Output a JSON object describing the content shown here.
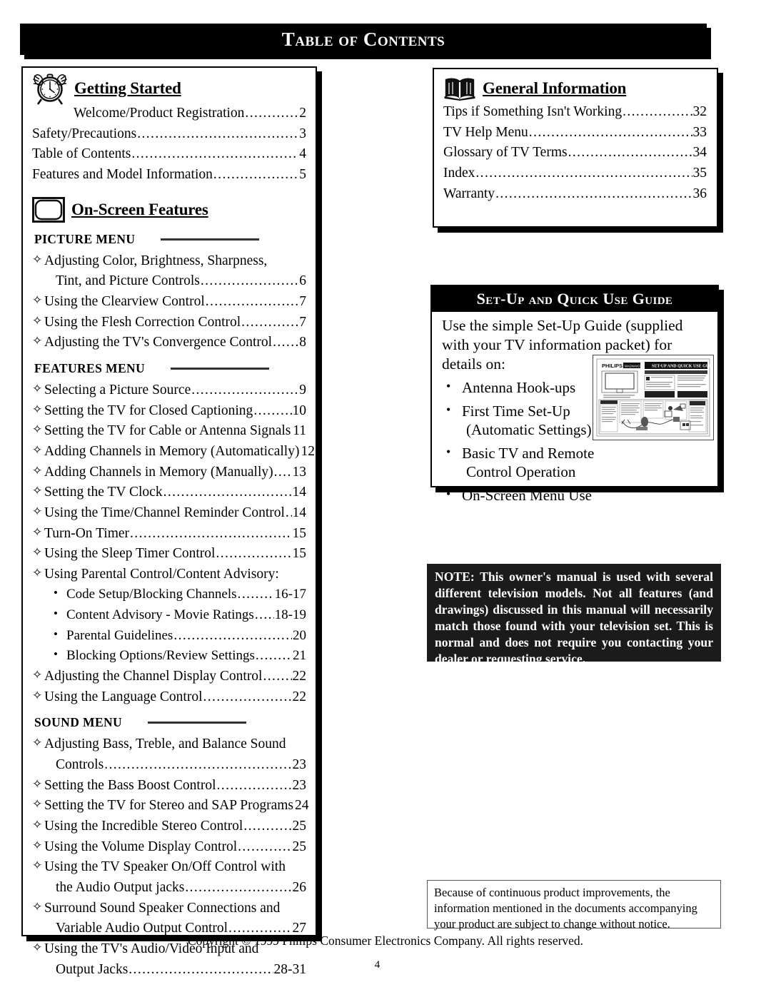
{
  "page": {
    "title": "Table of Contents",
    "page_number": "4",
    "copyright": "Copyright © 1999 Philips Consumer Electronics Company. All rights reserved.",
    "disclaimer": "Because of continuous product improvements, the information mentioned in the documents accompanying your product are subject to change without notice."
  },
  "left_column": {
    "getting_started": {
      "heading": "Getting Started",
      "icon": "alarm-clock-icon",
      "entries": [
        {
          "text": "Welcome/Product Registration",
          "page": "2",
          "indent": true
        },
        {
          "text": "Safety/Precautions",
          "page": "3",
          "indent": false
        },
        {
          "text": "Table of Contents",
          "page": "4",
          "indent": false
        },
        {
          "text": "Features and Model Information",
          "page": "5",
          "indent": false
        }
      ]
    },
    "on_screen_features": {
      "heading": "On-Screen Features",
      "icon": "tv-screen-icon",
      "menus": [
        {
          "label": "PICTURE MENU",
          "entries": [
            {
              "text": "Adjusting Color, Brightness, Sharpness,",
              "page": "",
              "wrap": "Tint, and Picture Controls",
              "wrap_page": "6"
            },
            {
              "text": "Using the Clearview Control",
              "page": "7"
            },
            {
              "text": "Using the Flesh Correction Control",
              "page": "7"
            },
            {
              "text": "Adjusting the TV's Convergence Control",
              "page": "8"
            }
          ]
        },
        {
          "label": "FEATURES MENU",
          "entries": [
            {
              "text": "Selecting a Picture Source",
              "page": "9"
            },
            {
              "text": "Setting the TV for Closed Captioning",
              "page": "10"
            },
            {
              "text": "Setting the TV for Cable or Antenna Signals",
              "page": "11"
            },
            {
              "text": "Adding Channels in Memory (Automatically)",
              "page": "12"
            },
            {
              "text": "Adding Channels in Memory (Manually)",
              "page": "13"
            },
            {
              "text": "Setting the TV Clock",
              "page": "14"
            },
            {
              "text": "Using the Time/Channel Reminder Control",
              "page": "14"
            },
            {
              "text": "Turn-On Timer",
              "page": "15"
            },
            {
              "text": "Using the Sleep Timer Control",
              "page": "15"
            },
            {
              "text": "Using Parental Control/Content Advisory:",
              "page": ""
            }
          ],
          "sub_entries": [
            {
              "text": "Code Setup/Blocking Channels",
              "page": "16-17"
            },
            {
              "text": "Content Advisory - Movie Ratings",
              "page": "18-19"
            },
            {
              "text": "Parental Guidelines",
              "page": "20"
            },
            {
              "text": "Blocking Options/Review Settings",
              "page": "21"
            }
          ],
          "entries_after": [
            {
              "text": "Adjusting the Channel Display Control",
              "page": "22"
            },
            {
              "text": "Using the Language Control",
              "page": "22"
            }
          ]
        },
        {
          "label": "SOUND MENU",
          "entries": [
            {
              "text": "Adjusting Bass, Treble, and Balance Sound",
              "page": "",
              "wrap": "Controls",
              "wrap_page": "23"
            },
            {
              "text": "Setting the Bass Boost Control",
              "page": "23"
            },
            {
              "text": "Setting the TV for Stereo and SAP Programs",
              "page": "24"
            },
            {
              "text": "Using the Incredible Stereo Control",
              "page": "25"
            },
            {
              "text": "Using the Volume Display Control",
              "page": "25"
            },
            {
              "text": "Using the TV Speaker On/Off Control with",
              "page": "",
              "wrap": "the Audio Output jacks",
              "wrap_page": "26"
            },
            {
              "text": "Surround Sound Speaker Connections and",
              "page": "",
              "wrap": "Variable Audio Output Control",
              "wrap_page": "27"
            },
            {
              "text": "Using the TV's Audio/Video Input and",
              "page": "",
              "wrap": "Output Jacks",
              "wrap_page": "28-31"
            }
          ]
        }
      ]
    }
  },
  "right_column": {
    "general_information": {
      "heading": "General Information",
      "icon": "open-book-icon",
      "entries": [
        {
          "text": "Tips if Something Isn't Working",
          "page": "32"
        },
        {
          "text": "TV Help Menu",
          "page": "33"
        },
        {
          "text": "Glossary of TV Terms",
          "page": "34"
        },
        {
          "text": "Index",
          "page": "35"
        },
        {
          "text": "Warranty",
          "page": "36"
        }
      ]
    },
    "setup_guide": {
      "header": "Set-Up and Quick Use Guide",
      "lead": "Use the simple Set-Up Guide (supplied with your TV information packet) for details on:",
      "bullets": [
        {
          "line1": "Antenna Hook-ups",
          "line2": ""
        },
        {
          "line1": "First Time Set-Up",
          "line2": "(Automatic Settings)"
        },
        {
          "line1": "Basic TV and Remote",
          "line2": "Control Operation"
        },
        {
          "line1": "On-Screen Menu Use",
          "line2": ""
        }
      ],
      "thumbnail": {
        "brand": "PHILIPS",
        "subbrand": "MAGNAVOX",
        "caption": "SET-UP AND QUICK USE GUIDE"
      }
    },
    "note": {
      "text": "NOTE: This owner's manual is used with several different television models.  Not all features (and  drawings) discussed in this manual will necessarily match those found with your television set. This is normal and does not require you contacting your dealer or requesting service."
    }
  },
  "glyphs": {
    "diamond": "✧",
    "bullet": "•",
    "leader": "......................................................................................................."
  }
}
